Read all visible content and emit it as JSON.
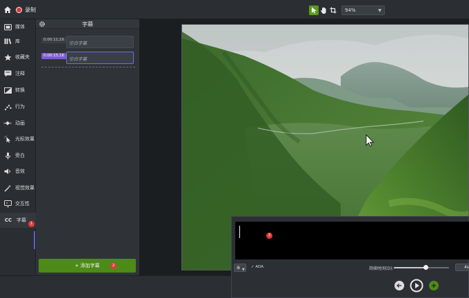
{
  "topbar": {
    "record_label": "录制",
    "zoom_value": "94%",
    "tools": [
      "select-arrow-icon",
      "hand-pan-icon",
      "crop-icon"
    ]
  },
  "sidebar": {
    "items": [
      {
        "label": "媒体",
        "icon": "media-icon"
      },
      {
        "label": "库",
        "icon": "library-icon"
      },
      {
        "label": "收藏夹",
        "icon": "star-icon"
      },
      {
        "label": "注释",
        "icon": "annotation-icon"
      },
      {
        "label": "转换",
        "icon": "transition-icon"
      },
      {
        "label": "行为",
        "icon": "behavior-icon"
      },
      {
        "label": "动画",
        "icon": "animation-icon"
      },
      {
        "label": "光标效果",
        "icon": "cursor-effect-icon"
      },
      {
        "label": "旁白",
        "icon": "microphone-icon"
      },
      {
        "label": "音效",
        "icon": "speaker-icon"
      },
      {
        "label": "视觉效果",
        "icon": "magic-wand-icon"
      },
      {
        "label": "交互性",
        "icon": "interactivity-icon"
      },
      {
        "label": "字幕",
        "icon": "cc-icon"
      }
    ],
    "callout_1": "1"
  },
  "captions_panel": {
    "title": "字幕",
    "rows": [
      {
        "time": "0:00:11;16",
        "text": "空白字幕"
      },
      {
        "time": "0:00:15;16",
        "text": "空白字幕"
      }
    ],
    "add_button_label": "+ 添加字幕",
    "callout_2": "2"
  },
  "caption_editor": {
    "callout_3": "3",
    "font_button": "a",
    "ada_label": "✓ ADA",
    "duration_label": "持续时间(D):",
    "duration_value": "4s",
    "duration_slider_fraction": 0.58
  },
  "colors": {
    "accent_green": "#4d8a18",
    "active_purple": "#7d5bd4",
    "record_red": "#e1343a",
    "callout_red": "#e23a36"
  }
}
